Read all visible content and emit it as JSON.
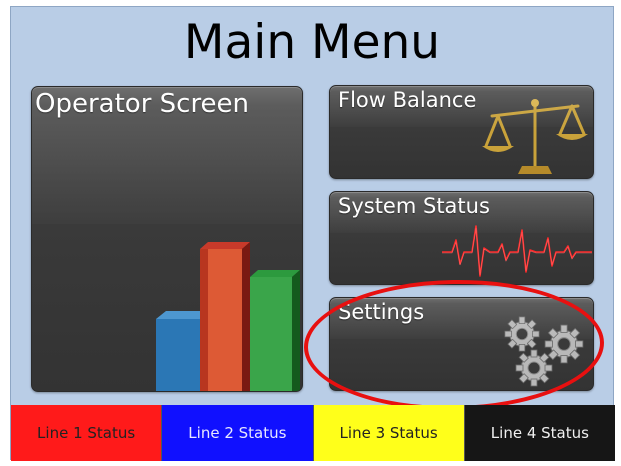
{
  "main_menu": {
    "title": "Main Menu"
  },
  "tiles": {
    "operator": {
      "label": "Operator Screen"
    },
    "flow_balance": {
      "label": "Flow Balance"
    },
    "system_status": {
      "label": "System Status"
    },
    "settings": {
      "label": "Settings"
    }
  },
  "status_bar": {
    "line1": {
      "label": "Line 1 Status",
      "color": "#ff1a1a"
    },
    "line2": {
      "label": "Line 2 Status",
      "color": "#1010ff"
    },
    "line3": {
      "label": "Line 3 Status",
      "color": "#ffff1a"
    },
    "line4": {
      "label": "Line 4 Status",
      "color": "#161616"
    }
  },
  "icons": {
    "operator": "bar-chart-icon",
    "flow_balance": "balance-scale-icon",
    "system_status": "heartbeat-icon",
    "settings": "gears-icon"
  },
  "highlight": {
    "target": "settings",
    "color": "#e81010"
  }
}
